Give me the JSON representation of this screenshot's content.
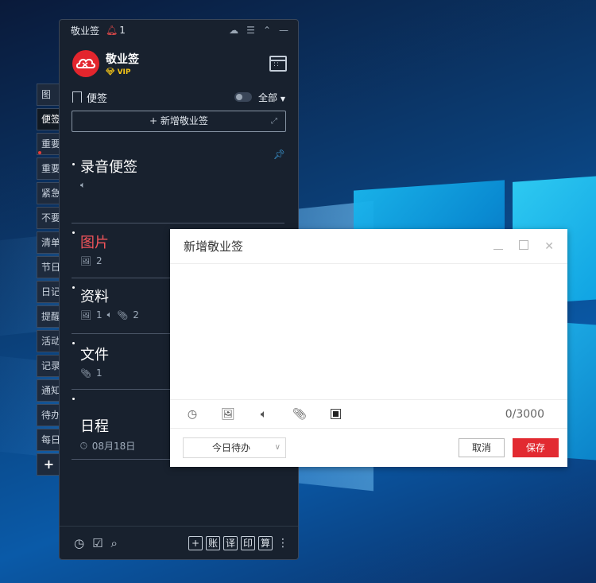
{
  "side_tabs": [
    "图",
    "便签",
    "重要",
    "重要",
    "紧急",
    "不要",
    "清单",
    "节日",
    "日记",
    "提醒",
    "活动",
    "记录",
    "通知",
    "待办",
    "每日",
    "+"
  ],
  "app": {
    "title": "敬业签",
    "notif_count": "1",
    "profile_name": "敬业签",
    "vip_label": "VIP",
    "section_label": "便签",
    "filter_label": "全部",
    "add_button_label": "新增敬业签"
  },
  "notes": [
    {
      "title": "录音便签",
      "meta": [
        {
          "icon": "audio-icon",
          "text": ""
        }
      ],
      "color": "#ffffff"
    },
    {
      "title": "图片",
      "meta": [
        {
          "icon": "image-icon",
          "text": "2"
        }
      ],
      "color": "#f0545a"
    },
    {
      "title": "资料",
      "meta": [
        {
          "icon": "image-icon",
          "text": "1"
        },
        {
          "icon": "audio-icon",
          "text": ""
        },
        {
          "icon": "attachment-icon",
          "text": "2"
        }
      ],
      "color": "#ffffff"
    },
    {
      "title": "文件",
      "meta": [
        {
          "icon": "attachment-icon",
          "text": "1"
        }
      ],
      "color": "#ffffff"
    },
    {
      "title": "日程",
      "meta": [
        {
          "icon": "clock-icon",
          "text": "08月18日"
        }
      ],
      "color": "#ffffff"
    }
  ],
  "bottom_tools": [
    "+",
    "账",
    "译",
    "印",
    "算"
  ],
  "dialog": {
    "title": "新增敬业签",
    "counter": "0/3000",
    "select_value": "今日待办",
    "cancel_label": "取消",
    "save_label": "保存"
  },
  "colors": {
    "brand_red": "#e3252d",
    "save_red": "#e22a31",
    "vip_gold": "#f5c518",
    "pin_blue": "#3fa6e8"
  }
}
